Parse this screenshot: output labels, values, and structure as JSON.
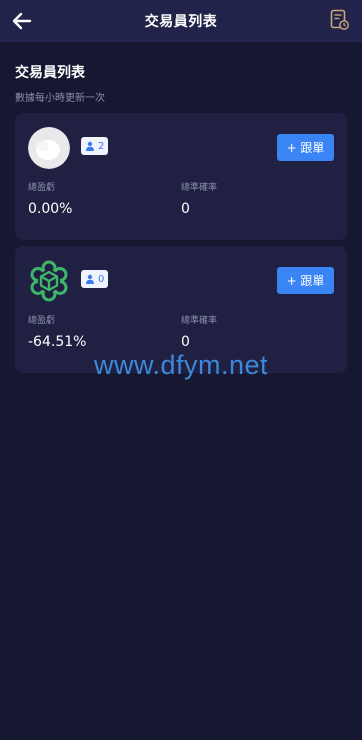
{
  "header": {
    "title": "交易員列表",
    "back_icon": "arrow-left-icon",
    "history_icon": "document-clock-icon"
  },
  "page": {
    "heading": "交易員列表",
    "subtitle": "數據每小時更新一次"
  },
  "traders": [
    {
      "avatar_icon": "default-avatar",
      "followers": "2",
      "follow_label": "+ 跟單",
      "pnl_label": "總盈虧",
      "pnl_value": "0.00%",
      "rate_label": "總準確率",
      "rate_value": "0"
    },
    {
      "avatar_icon": "green-cube-logo",
      "followers": "0",
      "follow_label": "+ 跟單",
      "pnl_label": "總盈虧",
      "pnl_value": "-64.51%",
      "rate_label": "總準確率",
      "rate_value": "0"
    }
  ],
  "watermark": "www.dfym.net",
  "colors": {
    "background": "#161730",
    "header": "#22234a",
    "card": "#1f2042",
    "accent": "#3a84f6",
    "muted": "#8c8fae"
  }
}
